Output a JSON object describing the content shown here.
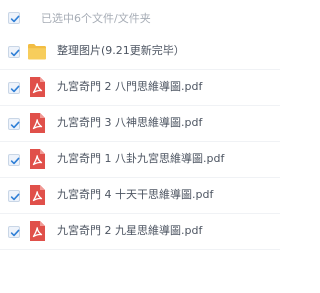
{
  "selection": {
    "summary": "已选中6个文件/文件夹",
    "all_checked": true
  },
  "items": [
    {
      "type": "folder",
      "icon": "folder-icon",
      "name": "整理图片(9.21更新完毕）",
      "checked": true
    },
    {
      "type": "pdf",
      "icon": "pdf-icon",
      "name": "九宮奇門 2 八門思維導圖.pdf",
      "checked": true
    },
    {
      "type": "pdf",
      "icon": "pdf-icon",
      "name": "九宮奇門 3 八神思維導圖.pdf",
      "checked": true
    },
    {
      "type": "pdf",
      "icon": "pdf-icon",
      "name": "九宮奇門 1 八卦九宮思維導圖.pdf",
      "checked": true
    },
    {
      "type": "pdf",
      "icon": "pdf-icon",
      "name": "九宮奇門 4 十天干思維導圖.pdf",
      "checked": true
    },
    {
      "type": "pdf",
      "icon": "pdf-icon",
      "name": "九宮奇門 2 九星思維導圖.pdf",
      "checked": true
    }
  ],
  "colors": {
    "check": "#2f7fd6",
    "folder": "#f4c24d",
    "pdf": "#e0504a"
  }
}
